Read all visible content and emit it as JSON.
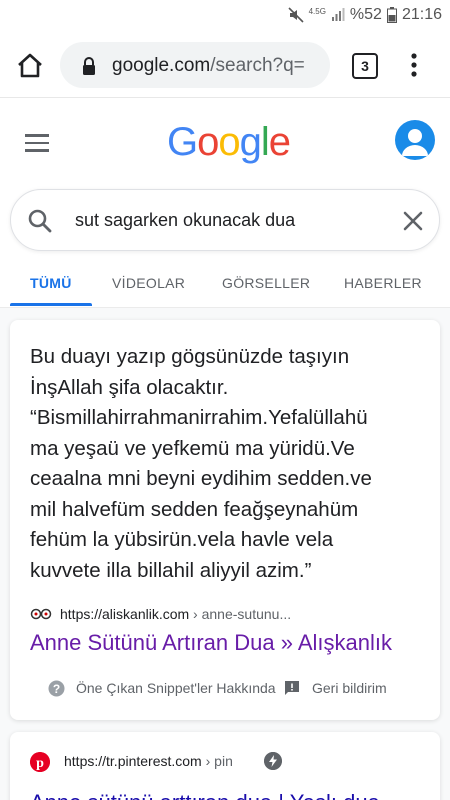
{
  "status_bar": {
    "network": "4.5G",
    "battery": "%52",
    "time": "21:16"
  },
  "browser": {
    "url_domain": "google.com",
    "url_path": "/search?q=",
    "tab_count": "3",
    "icons": [
      "home-icon",
      "lock-icon",
      "tabs-icon",
      "more-vert-icon"
    ]
  },
  "header": {
    "logo_letters": [
      "G",
      "o",
      "o",
      "g",
      "l",
      "e"
    ],
    "logo_colors": [
      "#4285f4",
      "#ea4335",
      "#fbbc05",
      "#4285f4",
      "#34a853",
      "#ea4335"
    ]
  },
  "search": {
    "query": "sut sagarken okunacak dua"
  },
  "tabs": [
    {
      "label": "TÜMÜ",
      "active": true
    },
    {
      "label": "VİDEOLAR",
      "active": false
    },
    {
      "label": "GÖRSELLER",
      "active": false
    },
    {
      "label": "HABERLER",
      "active": false
    }
  ],
  "featured_snippet": {
    "lines": [
      "Bu duayı yazıp gögsünüzde taşıyın",
      "İnşAllah şifa olacaktır.",
      "“Bismillahirrahmanirrahim.Yefalüllahü",
      "ma yeşaü ve yefkemü ma yüridü.Ve",
      "ceaalna mni beyni eydihim sedden.ve",
      "mil halvefüm sedden feağşeynahüm",
      "fehüm la yübsirün.vela havle vela",
      "kuvvete illa billahil aliyyil azim.”"
    ],
    "source_domain": "https://aliskanlik.com",
    "source_path": " › anne-sutunu...",
    "title": "Anne Sütünü Artıran Dua » Alışkanlık",
    "about_label": "Öne Çıkan Snippet'ler Hakkında",
    "feedback_label": "Geri bildirim"
  },
  "second_result": {
    "source_domain": "https://tr.pinterest.com",
    "source_path": " › pin",
    "title": "Anne sütünü arttıran dua | Yaşlı dua..."
  }
}
